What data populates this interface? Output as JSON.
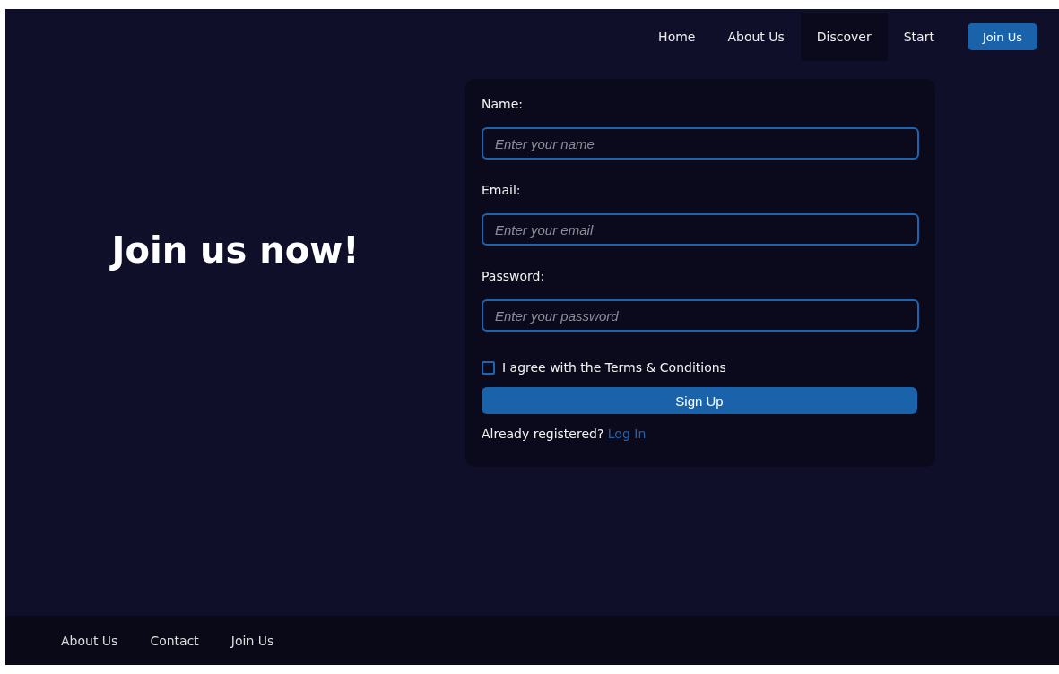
{
  "nav": {
    "links": [
      {
        "label": "Home",
        "selected": false
      },
      {
        "label": "About Us",
        "selected": false
      },
      {
        "label": "Discover",
        "selected": true
      },
      {
        "label": "Start",
        "selected": false
      }
    ],
    "cta": "Join Us"
  },
  "hero": {
    "heading": "Join us now!"
  },
  "form": {
    "fields": [
      {
        "label": "Name:",
        "placeholder": "Enter your name"
      },
      {
        "label": "Email:",
        "placeholder": "Enter your email"
      },
      {
        "label": "Password:",
        "placeholder": "Enter your password"
      }
    ],
    "agree": {
      "label": "I agree with the Terms & Conditions",
      "checked": false
    },
    "submit": "Sign Up",
    "login_prompt": "Already registered?",
    "login_link": "Log In"
  },
  "footer": {
    "links": [
      "About Us",
      "Contact",
      "Join Us"
    ]
  }
}
